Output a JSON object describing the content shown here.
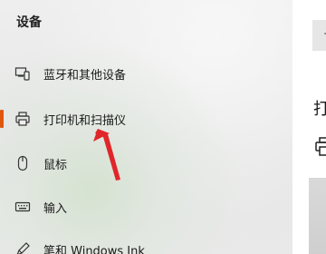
{
  "sidebar": {
    "title": "设备",
    "items": [
      {
        "label": "蓝牙和其他设备",
        "icon": "bluetooth-devices-icon",
        "selected": false
      },
      {
        "label": "打印机和扫描仪",
        "icon": "printer-icon",
        "selected": true
      },
      {
        "label": "鼠标",
        "icon": "mouse-icon",
        "selected": false
      },
      {
        "label": "输入",
        "icon": "keyboard-icon",
        "selected": false
      },
      {
        "label": "笔和 Windows Ink",
        "icon": "pen-icon",
        "selected": false
      }
    ]
  },
  "content": {
    "add_glyph": "+",
    "heading_partial": "打",
    "device_icon": "printer-icon"
  },
  "annotation": {
    "arrow_color": "#e0262a",
    "accent_color": "#e0570f"
  }
}
